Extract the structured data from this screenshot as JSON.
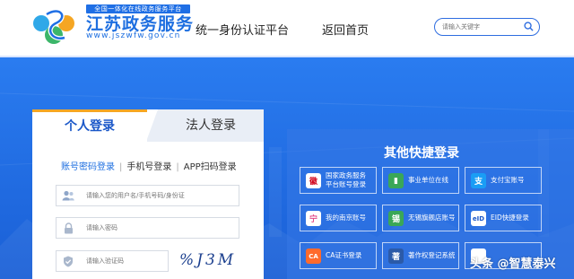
{
  "header": {
    "tagline": "全国一体化在线政务服务平台",
    "site_name": "江苏政务服务",
    "site_url": "www.jszwfw.gov.cn",
    "nav": [
      "统一身份认证平台",
      "返回首页"
    ],
    "search_placeholder": "请输入关键字"
  },
  "login": {
    "tabs": [
      "个人登录",
      "法人登录"
    ],
    "methods": [
      "账号密码登录",
      "手机号登录",
      "APP扫码登录"
    ],
    "username_placeholder": "请输入您的用户名/手机号码/身份证",
    "password_placeholder": "请输入密码",
    "captcha_placeholder": "请输入验证码",
    "captcha_text": "%J3M"
  },
  "quick_login": {
    "title": "其他快捷登录",
    "items": [
      {
        "label_1": "国家政务服务",
        "label_2": "平台账号登录",
        "icon": "national-emblem-icon",
        "color": "#ffffff"
      },
      {
        "label_1": "事业单位在线",
        "label_2": "",
        "icon": "institution-icon",
        "color": "#3aa757"
      },
      {
        "label_1": "支付宝账号",
        "label_2": "",
        "icon": "alipay-icon",
        "color": "#1a9df5"
      },
      {
        "label_1": "我的南京账号",
        "label_2": "",
        "icon": "my-nanjing-icon",
        "color": "#ffffff"
      },
      {
        "label_1": "无锡旗舰店账号",
        "label_2": "",
        "icon": "wuxi-icon",
        "color": "#3aa757"
      },
      {
        "label_1": "EID快捷登录",
        "label_2": "",
        "icon": "eid-icon",
        "color": "#ffffff"
      },
      {
        "label_1": "CA证书登录",
        "label_2": "",
        "icon": "ca-certificate-icon",
        "color": "#ff6a2c"
      },
      {
        "label_1": "著作权登记系统",
        "label_2": "",
        "icon": "copyright-icon",
        "color": "#2b5aa8"
      },
      {
        "label_1": "",
        "label_2": "",
        "icon": "other-icon",
        "color": "#ffffff"
      }
    ],
    "icon_glyphs": [
      "徽",
      "▮",
      "支",
      "宁",
      "锡",
      "eID",
      "CA",
      "著",
      ""
    ]
  },
  "watermark": "头条 @智慧泰兴"
}
